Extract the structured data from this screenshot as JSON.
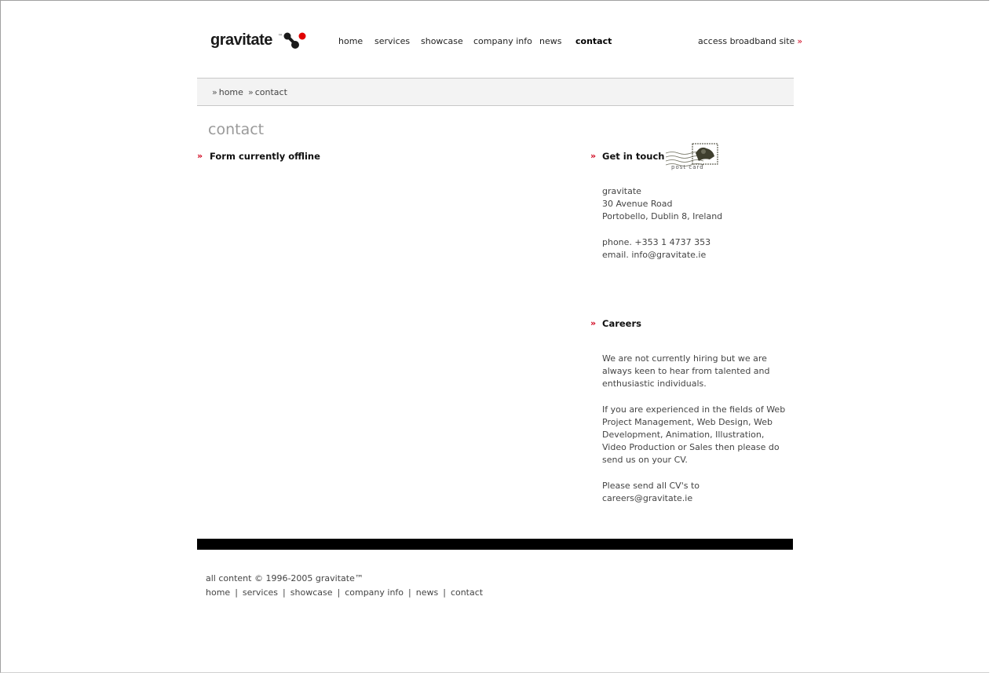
{
  "brand": {
    "name": "gravitate",
    "tm": "™"
  },
  "nav": {
    "items": [
      {
        "label": "home",
        "active": false
      },
      {
        "label": "services",
        "active": false
      },
      {
        "label": "showcase",
        "active": false
      },
      {
        "label": "company info",
        "active": false
      },
      {
        "label": "news",
        "active": false
      },
      {
        "label": "contact",
        "active": true
      }
    ],
    "broadband_label": "access broadband site",
    "broadband_arrow": "»"
  },
  "breadcrumb": [
    {
      "label": "home"
    },
    {
      "label": "contact"
    }
  ],
  "breadcrumb_sep": "»",
  "page_title": "contact",
  "form_section": {
    "arrow": "»",
    "title": "Form currently offline"
  },
  "get_in_touch": {
    "arrow": "»",
    "title": "Get in touch",
    "stamp_label": "post card",
    "address": [
      "gravitate",
      "30 Avenue Road",
      "Portobello, Dublin 8, Ireland"
    ],
    "phone": "phone. +353 1 4737 353",
    "email": "email. info@gravitate.ie"
  },
  "careers": {
    "arrow": "»",
    "title": "Careers",
    "para1": [
      "We are not currently hiring but we are",
      "always keen to hear from talented and",
      "enthusiastic individuals."
    ],
    "para2": [
      "If you are experienced in the fields of Web",
      "Project Management, Web Design, Web",
      "Development, Animation, Illustration,",
      "Video Production or Sales then please do",
      "send us on your CV."
    ],
    "para3": [
      "Please send all CV's to",
      "careers@gravitate.ie"
    ]
  },
  "footer": {
    "copyright": "all content © 1996-2005 gravitate™",
    "links": [
      "home",
      "services",
      "showcase",
      "company info",
      "news",
      "contact"
    ],
    "separator": "|"
  },
  "colors": {
    "accent": "#d0021b",
    "bar": "#000000",
    "crumb_bg": "#f3f3f3",
    "title_gray": "#9a9a9a"
  }
}
